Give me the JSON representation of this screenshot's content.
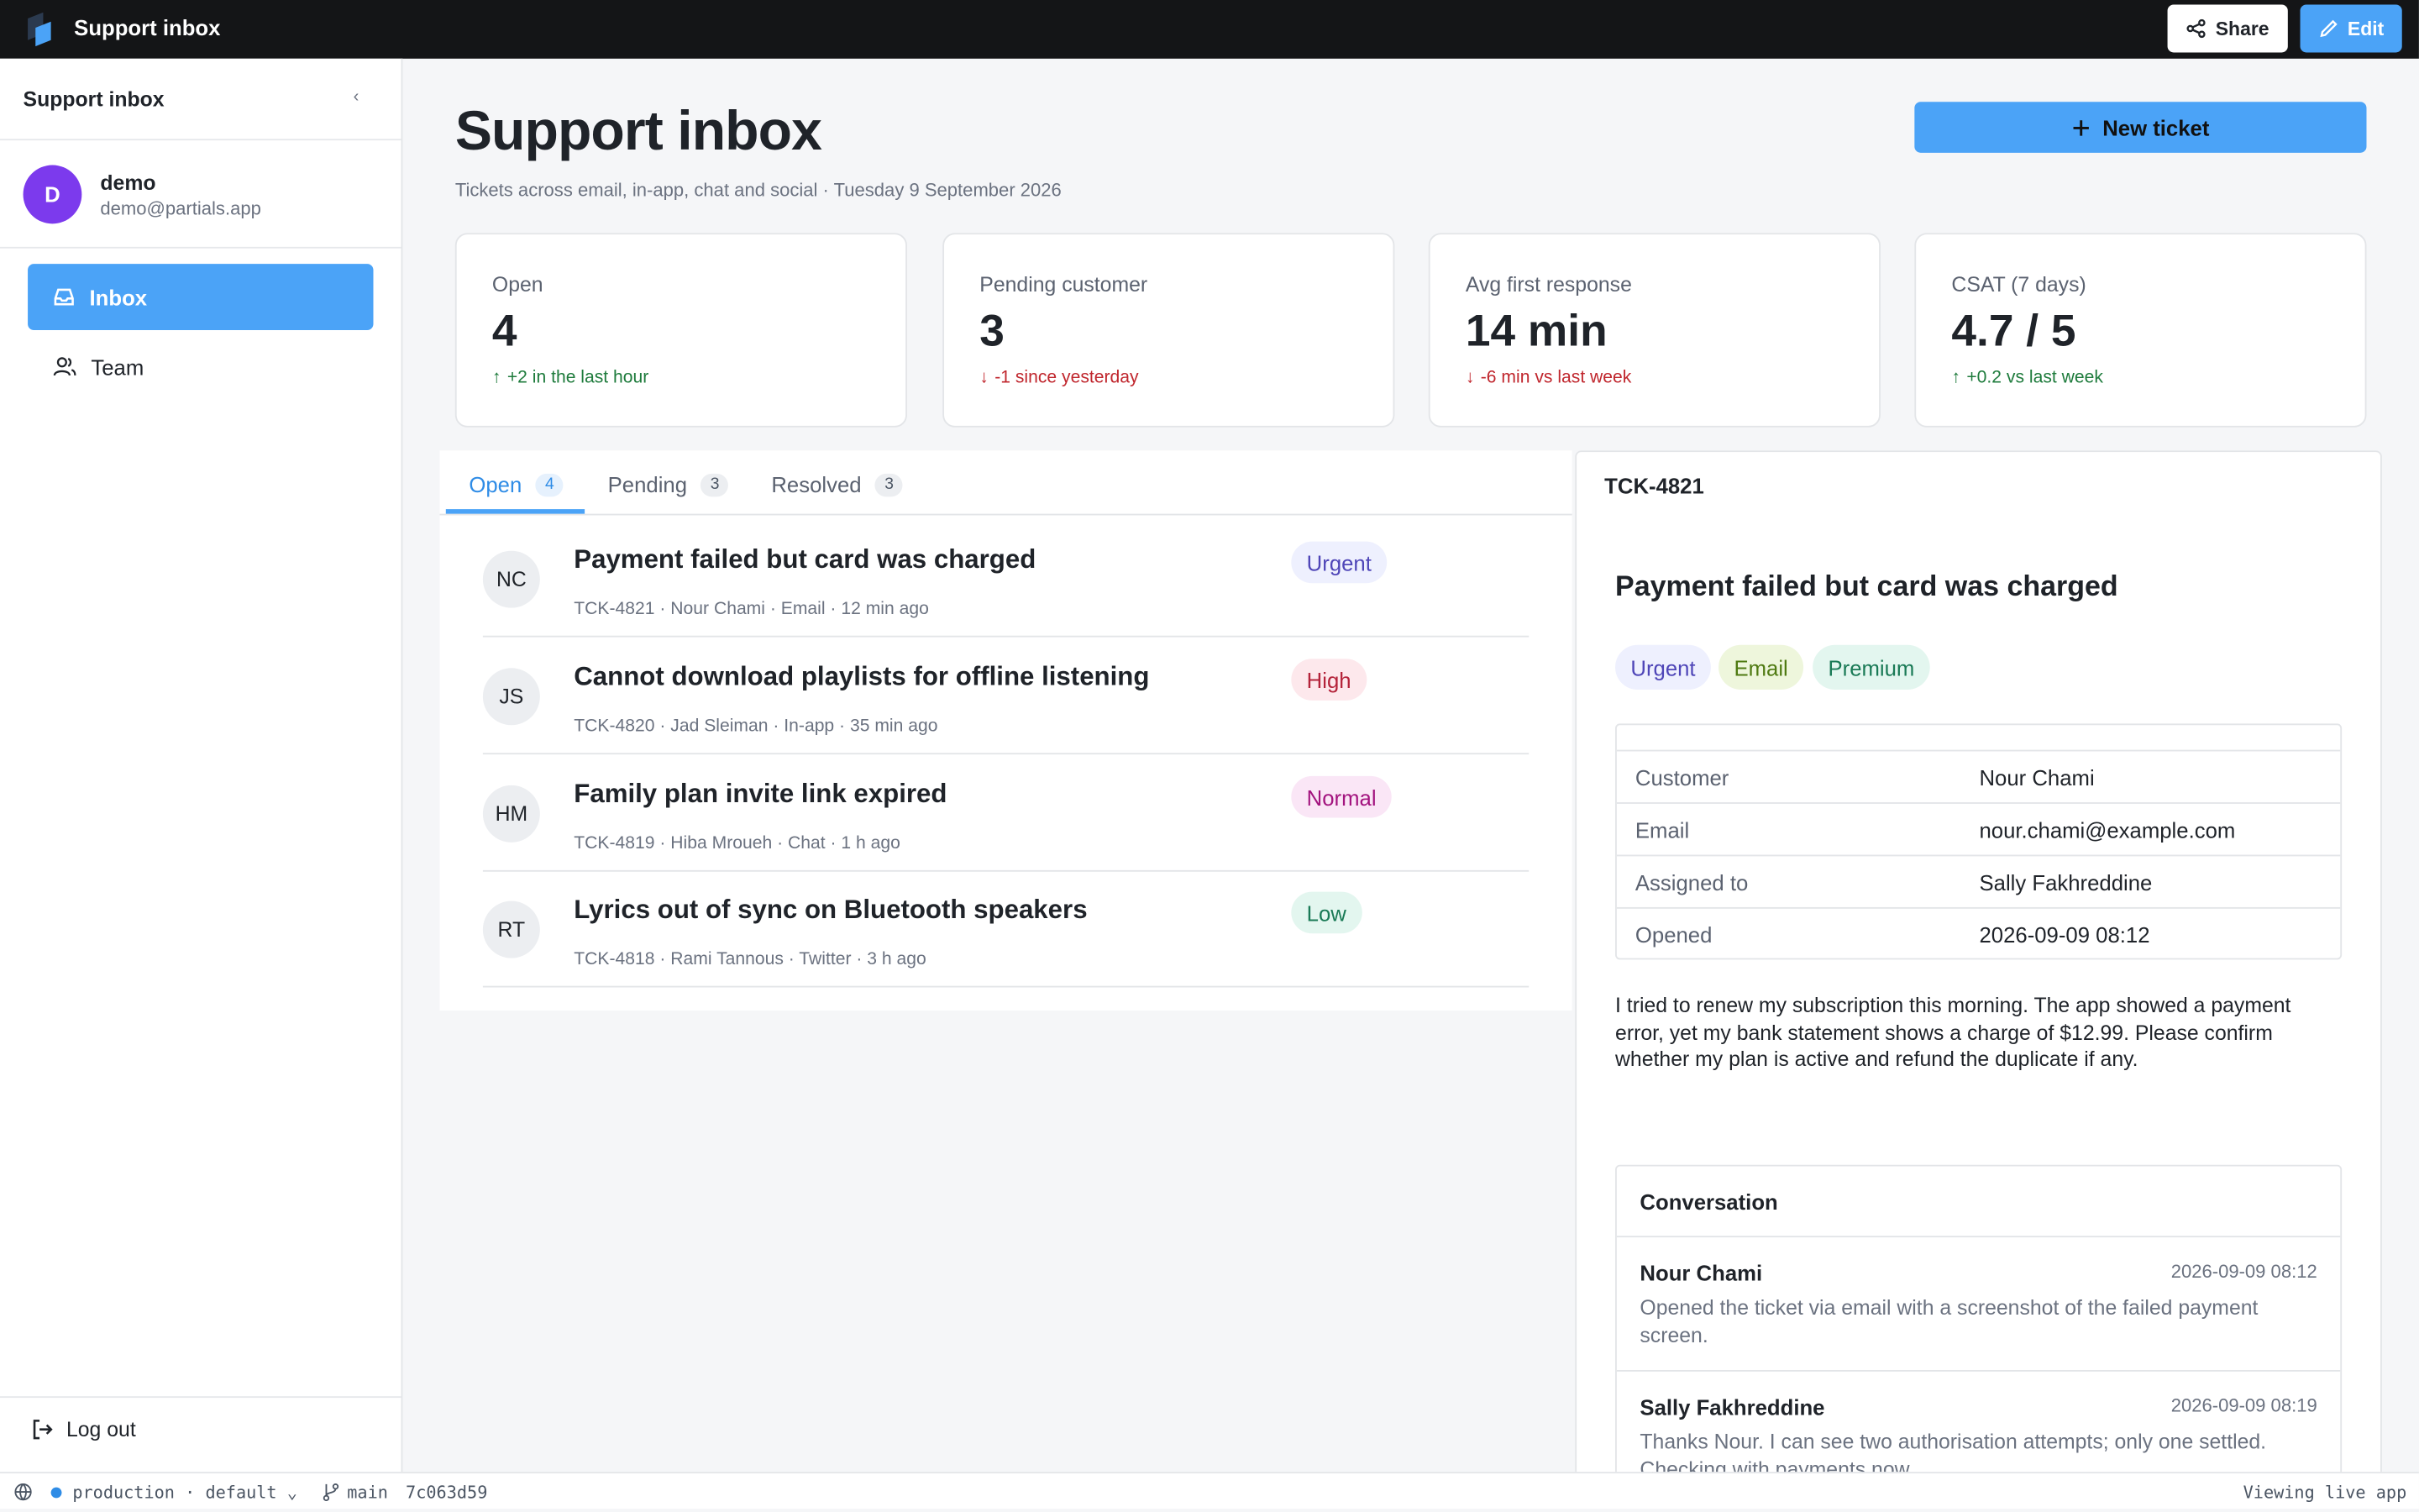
{
  "topbar": {
    "app_title": "Support inbox",
    "share_label": "Share",
    "edit_label": "Edit"
  },
  "sidebar": {
    "title": "Support inbox",
    "collapse_glyph": "‹",
    "user": {
      "initial": "D",
      "name": "demo",
      "email": "demo@partials.app"
    },
    "nav": [
      {
        "label": "Inbox",
        "icon": "inbox-icon",
        "active": true
      },
      {
        "label": "Team",
        "icon": "team-icon",
        "active": false
      }
    ],
    "logout_label": "Log out"
  },
  "header": {
    "title": "Support inbox",
    "subtitle": "Tickets across email, in-app, chat and social · Tuesday 9 September 2026",
    "new_ticket_label": "New ticket"
  },
  "stats": [
    {
      "label": "Open",
      "value": "4",
      "delta": "+2 in the last hour",
      "direction": "up"
    },
    {
      "label": "Pending customer",
      "value": "3",
      "delta": "-1 since yesterday",
      "direction": "down"
    },
    {
      "label": "Avg first response",
      "value": "14 min",
      "delta": "-6 min vs last week",
      "direction": "down"
    },
    {
      "label": "CSAT (7 days)",
      "value": "4.7 / 5",
      "delta": "+0.2 vs last week",
      "direction": "up"
    }
  ],
  "tabs": [
    {
      "label": "Open",
      "count": "4",
      "active": true
    },
    {
      "label": "Pending",
      "count": "3",
      "active": false
    },
    {
      "label": "Resolved",
      "count": "3",
      "active": false
    }
  ],
  "tickets": [
    {
      "initials": "NC",
      "title": "Payment failed but card was charged",
      "meta": "TCK-4821 · Nour Chami · Email · 12 min ago",
      "priority": "Urgent"
    },
    {
      "initials": "JS",
      "title": "Cannot download playlists for offline listening",
      "meta": "TCK-4820 · Jad Sleiman · In-app · 35 min ago",
      "priority": "High"
    },
    {
      "initials": "HM",
      "title": "Family plan invite link expired",
      "meta": "TCK-4819 · Hiba Mroueh · Chat · 1 h ago",
      "priority": "Normal"
    },
    {
      "initials": "RT",
      "title": "Lyrics out of sync on Bluetooth speakers",
      "meta": "TCK-4818 · Rami Tannous · Twitter · 3 h ago",
      "priority": "Low"
    }
  ],
  "detail": {
    "id": "TCK-4821",
    "title": "Payment failed but card was charged",
    "tags": [
      "Urgent",
      "Email",
      "Premium"
    ],
    "fields": [
      {
        "key": "Customer",
        "value": "Nour Chami"
      },
      {
        "key": "Email",
        "value": "nour.chami@example.com"
      },
      {
        "key": "Assigned to",
        "value": "Sally Fakhreddine"
      },
      {
        "key": "Opened",
        "value": "2026-09-09 08:12"
      }
    ],
    "body": "I tried to renew my subscription this morning. The app showed a payment error, yet my bank statement shows a charge of $12.99. Please confirm whether my plan is active and refund the duplicate if any.",
    "conversation_title": "Conversation",
    "messages": [
      {
        "author": "Nour Chami",
        "time": "2026-09-09 08:12",
        "text": "Opened the ticket via email with a screenshot of the failed payment screen."
      },
      {
        "author": "Sally Fakhreddine",
        "time": "2026-09-09 08:19",
        "text": "Thanks Nour. I can see two authorisation attempts; only one settled. Checking with payments now."
      }
    ]
  },
  "statusbar": {
    "environment": "production · default",
    "branch": "main",
    "commit": "7c063d59",
    "mode": "Viewing live app"
  },
  "colors": {
    "accent": "#4ba3f7",
    "topbar": "#141517",
    "avatar": "#7c3aed",
    "up": "#1e7b3c",
    "down": "#c0262d"
  }
}
